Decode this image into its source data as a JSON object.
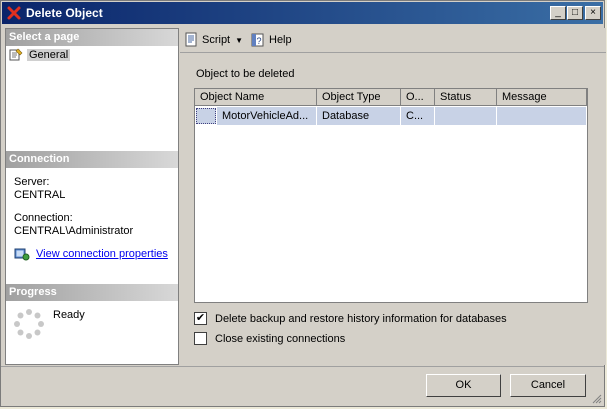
{
  "window": {
    "title": "Delete Object"
  },
  "left": {
    "select_page_header": "Select a page",
    "pages": [
      {
        "label": "General"
      }
    ],
    "connection_header": "Connection",
    "server_label": "Server:",
    "server_value": "CENTRAL",
    "connection_label": "Connection:",
    "connection_value": "CENTRAL\\Administrator",
    "view_props_link": "View connection properties",
    "progress_header": "Progress",
    "progress_status": "Ready"
  },
  "toolbar": {
    "script_label": "Script",
    "help_label": "Help"
  },
  "main": {
    "section_label": "Object to be deleted",
    "columns": [
      "Object Name",
      "Object Type",
      "O...",
      "Status",
      "Message"
    ],
    "rows": [
      {
        "name": "MotorVehicleAd...",
        "type": "Database",
        "owner": "C...",
        "status": "",
        "message": ""
      }
    ],
    "opt_delete_history": {
      "label": "Delete backup and restore history information for databases",
      "checked": "✔"
    },
    "opt_close_conn": {
      "label": "Close existing connections",
      "checked": ""
    }
  },
  "buttons": {
    "ok": "OK",
    "cancel": "Cancel"
  },
  "colors": {
    "title_bg": "#0a246a",
    "link": "#0000ee",
    "selected_row": "#c8d2e6"
  }
}
